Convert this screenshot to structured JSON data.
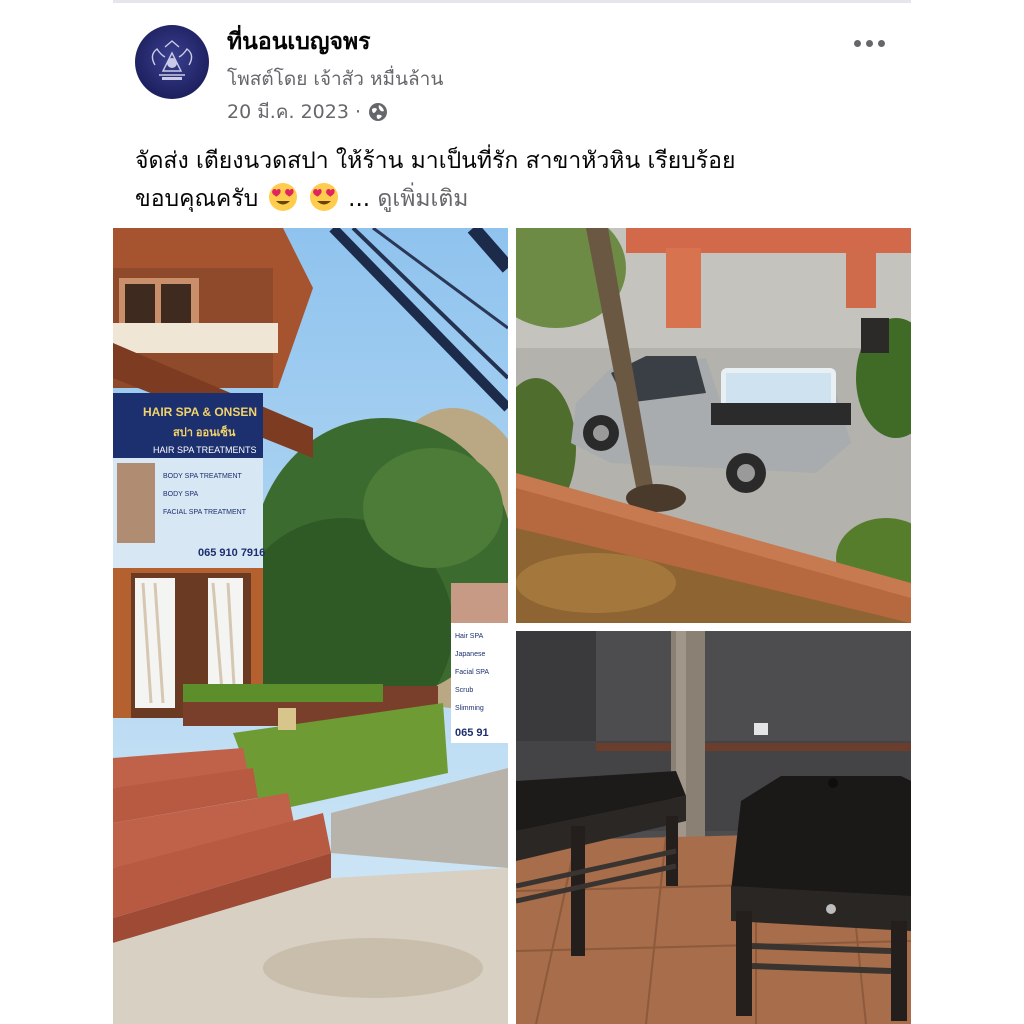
{
  "post": {
    "page_name": "ที่นอนเบญจพร",
    "posted_by": "โพสต์โดย เจ้าสัว หมื่นล้าน",
    "date": "20 มี.ค. 2023",
    "separator": "·",
    "privacy_icon": "globe-icon",
    "text_line1": "จัดส่ง เตียงนวดสปา ให้ร้าน มาเป็นที่รัก สาขาหัวหิน เรียบร้อย",
    "text_line2": "ขอบคุณครับ",
    "ellipsis": "...",
    "see_more": "ดูเพิ่มเติม",
    "emoji": "heart-eyes-emoji"
  },
  "photos": {
    "storefront": {
      "sign_title": "HAIR SPA & ONSEN",
      "sign_thai": "สปา ออนเซ็น",
      "sign_sub": "HAIR SPA TREATMENTS",
      "items": [
        "BODY SPA TREATMENT",
        "BODY SPA",
        "FACIAL SPA TREATMENT"
      ],
      "phone": "065 910 7916",
      "banner_lines": [
        "Hair SPA",
        "Japanese",
        "Facial SPA",
        "Scrub",
        "Slimming"
      ],
      "banner_phone": "065 91"
    }
  },
  "colors": {
    "name": "#050505",
    "secondary": "#65676b",
    "avatar_bg": "#1e2160"
  }
}
